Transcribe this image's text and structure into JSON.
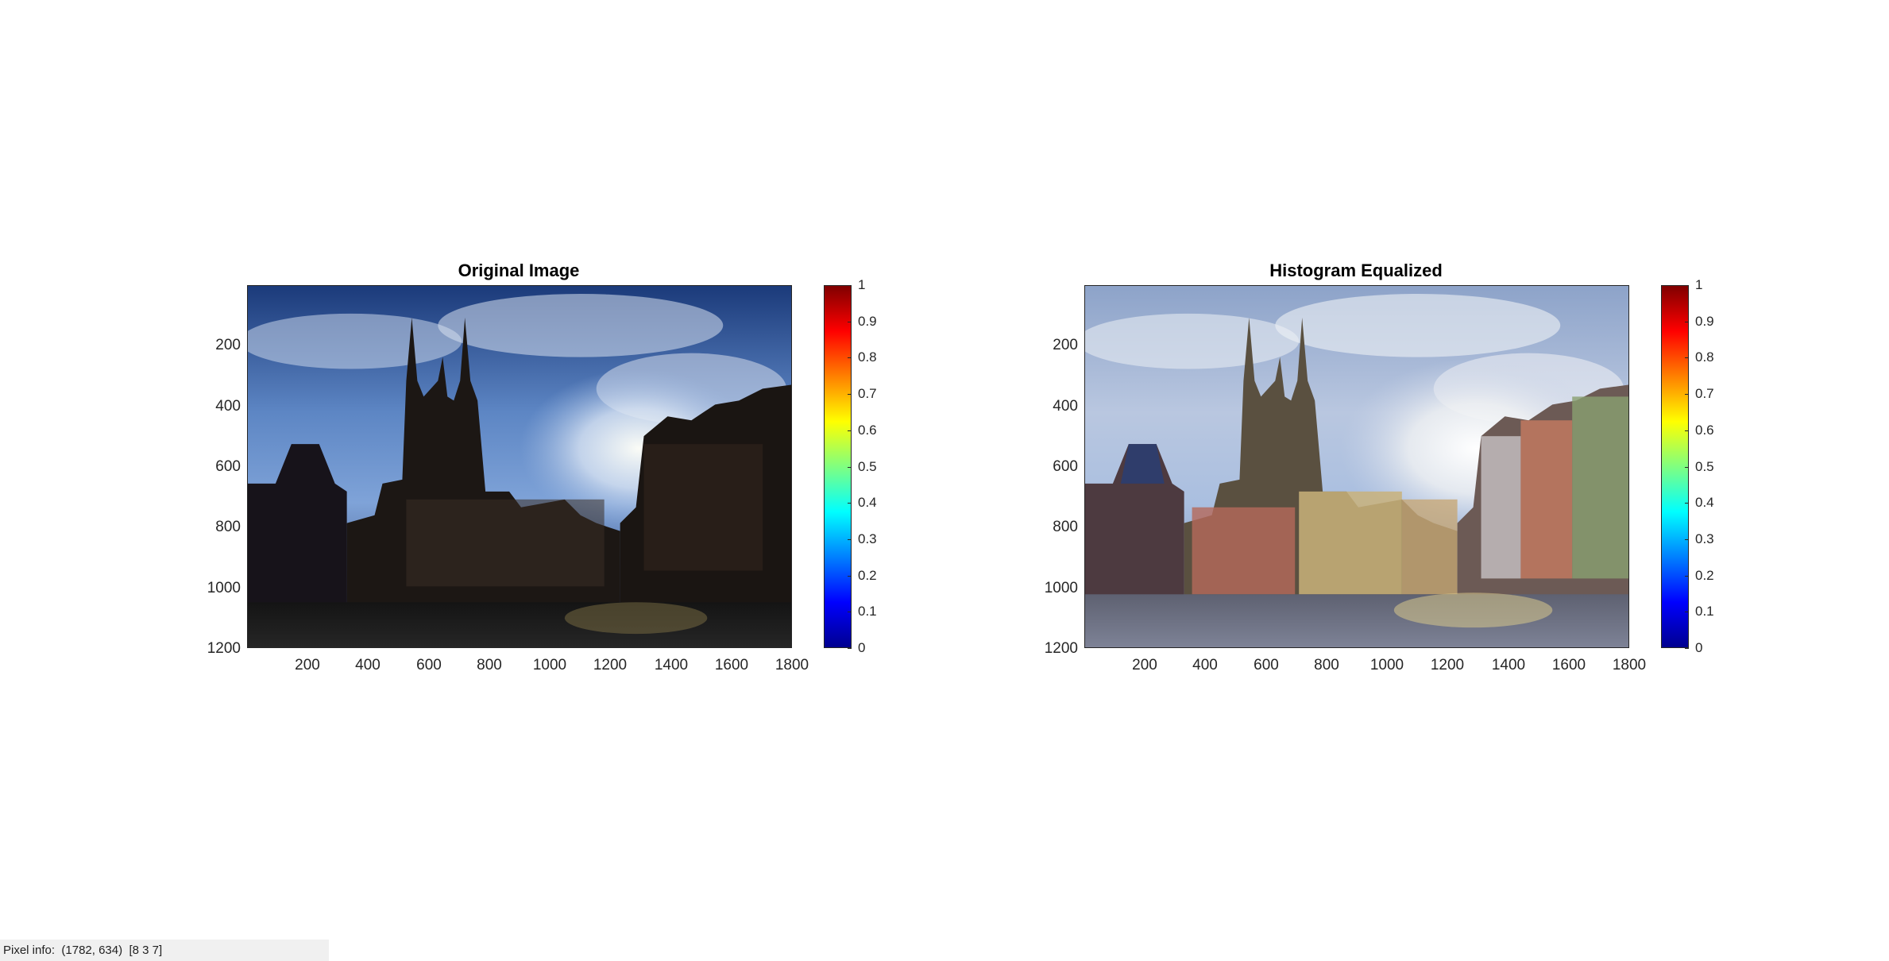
{
  "panels": [
    {
      "title": "Original Image",
      "y_ticks": [
        "200",
        "400",
        "600",
        "800",
        "1000",
        "1200"
      ],
      "x_ticks": [
        "200",
        "400",
        "600",
        "800",
        "1000",
        "1200",
        "1400",
        "1600",
        "1800"
      ],
      "colorbar_ticks": [
        "1",
        "0.9",
        "0.8",
        "0.7",
        "0.6",
        "0.5",
        "0.4",
        "0.3",
        "0.2",
        "0.1",
        "0"
      ]
    },
    {
      "title": "Histogram Equalized",
      "y_ticks": [
        "200",
        "400",
        "600",
        "800",
        "1000",
        "1200"
      ],
      "x_ticks": [
        "200",
        "400",
        "600",
        "800",
        "1000",
        "1200",
        "1400",
        "1600",
        "1800"
      ],
      "colorbar_ticks": [
        "1",
        "0.9",
        "0.8",
        "0.7",
        "0.6",
        "0.5",
        "0.4",
        "0.3",
        "0.2",
        "0.1",
        "0"
      ]
    }
  ],
  "status": {
    "label": "Pixel info:",
    "coords": "(1782, 634)",
    "rgb": "[8 3 7]"
  }
}
